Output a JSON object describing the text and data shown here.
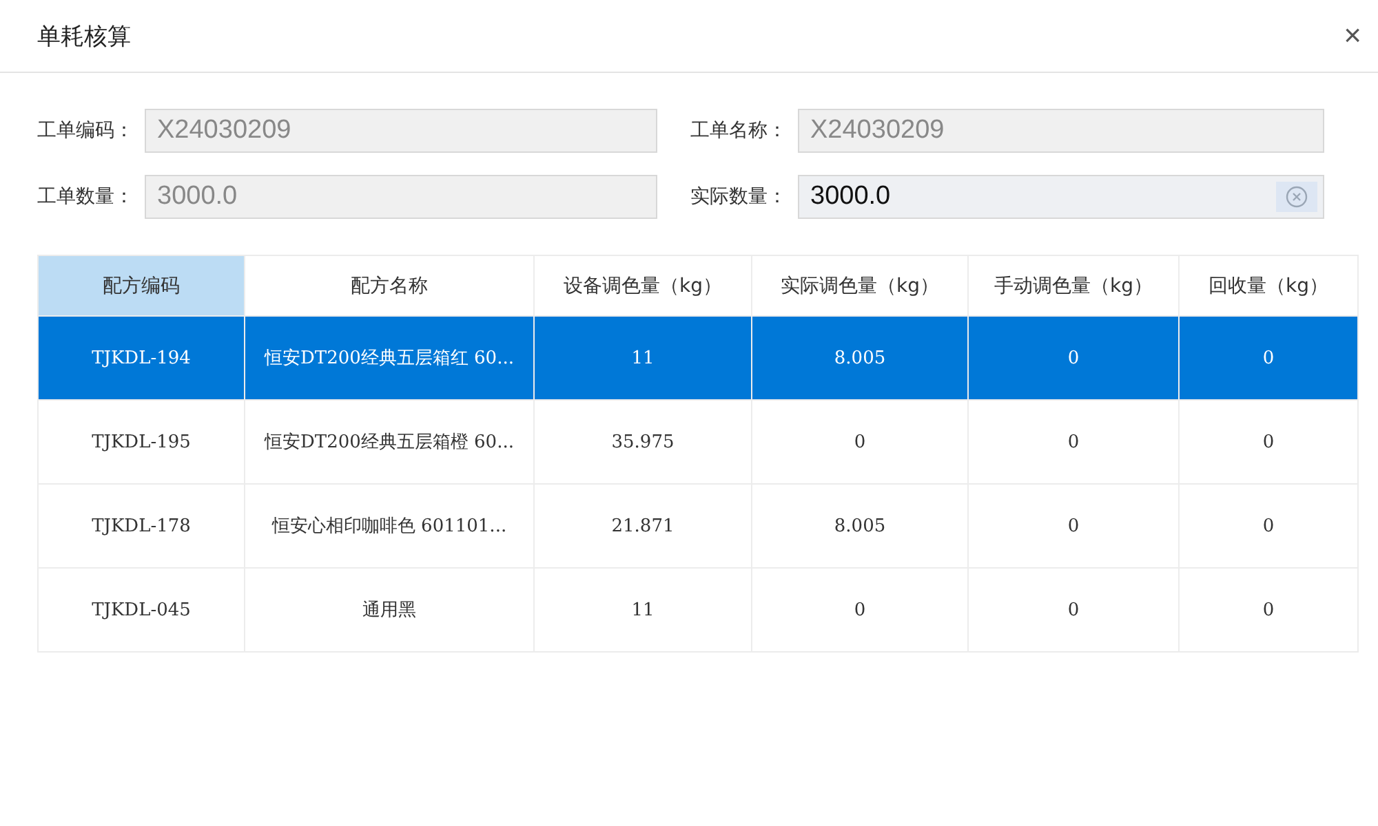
{
  "window": {
    "title": "单耗核算",
    "close": "×"
  },
  "fields": [
    {
      "label": "工单编码：",
      "value": "X24030209",
      "disabled": true
    },
    {
      "label": "工单名称：",
      "value": "X24030209",
      "disabled": true
    },
    {
      "label": "工单数量：",
      "value": "3000.0",
      "disabled": true
    },
    {
      "label": "实际数量：",
      "value": "3000.0",
      "disabled": false
    }
  ],
  "table": {
    "columns": [
      {
        "label": "配方编码",
        "selected": true
      },
      {
        "label": "配方名称",
        "selected": false
      },
      {
        "label": "设备调色量（kg）",
        "selected": false
      },
      {
        "label": "实际调色量（kg）",
        "selected": false
      },
      {
        "label": "手动调色量（kg）",
        "selected": false
      },
      {
        "label": "回收量（kg）",
        "selected": false
      }
    ],
    "rows": [
      {
        "selected": true,
        "cells": [
          "TJKDL-194",
          "恒安DT200经典五层箱红  60...",
          "11",
          "8.005",
          "0",
          "0"
        ]
      },
      {
        "selected": false,
        "cells": [
          "TJKDL-195",
          "恒安DT200经典五层箱橙  60...",
          "35.975",
          "0",
          "0",
          "0"
        ]
      },
      {
        "selected": false,
        "cells": [
          "TJKDL-178",
          "恒安心相印咖啡色   601101...",
          "21.871",
          "8.005",
          "0",
          "0"
        ]
      },
      {
        "selected": false,
        "cells": [
          "TJKDL-045",
          "通用黑",
          "11",
          "0",
          "0",
          "0"
        ]
      }
    ]
  }
}
